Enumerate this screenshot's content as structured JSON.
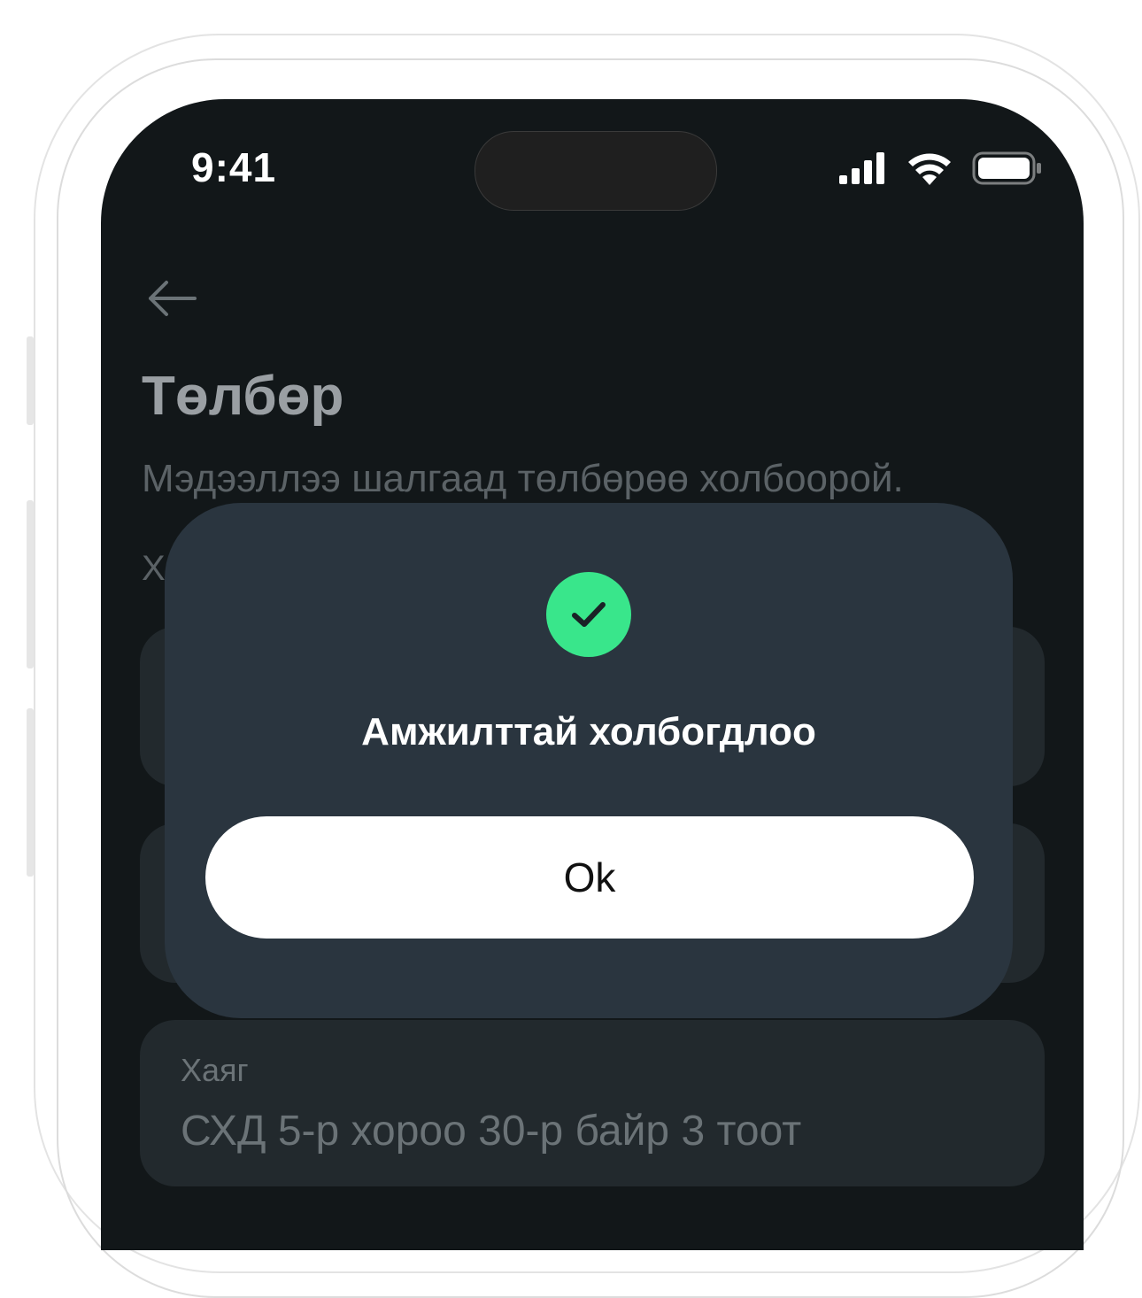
{
  "status_bar": {
    "time": "9:41",
    "signal_icon": "cellular-signal-icon",
    "wifi_icon": "wifi-icon",
    "battery_icon": "battery-icon"
  },
  "header": {
    "back_icon": "arrow-left-icon",
    "title": "Төлбөр",
    "subtitle": "Мэдээллээ шалгаад төлбөрөө холбоорой.",
    "section_label": "Х"
  },
  "fields": {
    "address": {
      "label": "Хаяг",
      "value": "СХД 5-р хороо 30-р байр 3 тоот"
    }
  },
  "dialog": {
    "icon": "check-circle-icon",
    "icon_color": "#39e68b",
    "title": "Амжилттай холбогдлоо",
    "ok_label": "Ok"
  }
}
